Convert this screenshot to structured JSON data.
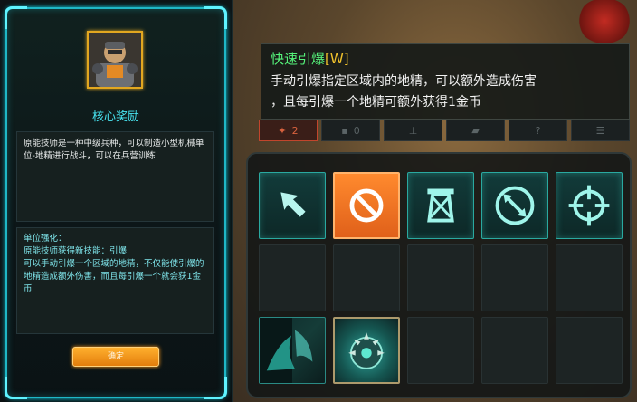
{
  "reward_panel": {
    "title": "核心奖励",
    "description": "原能技师是一种中级兵种，可以制造小型机械单位-地精进行战斗，可以在兵营训练",
    "upgrade_heading": "单位强化：",
    "upgrade_line1": "原能技师获得新技能：引爆",
    "upgrade_line2": "可以手动引爆一个区域的地精，不仅能使引爆的地精造成额外伤害，而且每引爆一个就会获1金币",
    "confirm_label": "确定"
  },
  "tooltip": {
    "title": "快速引爆",
    "hotkey": "[W]",
    "desc_line1": "手动引爆指定区域内的地精，可以额外造成伤害",
    "desc_line2": "，且每引爆一个地精可额外获得1金币"
  },
  "tabs": [
    {
      "icon": "unit-icon",
      "label": "2"
    },
    {
      "icon": "count-icon",
      "label": "0"
    },
    {
      "icon": "building-icon",
      "label": ""
    },
    {
      "icon": "flag-icon",
      "label": ""
    },
    {
      "icon": "help-icon",
      "label": "?"
    },
    {
      "icon": "list-icon",
      "label": ""
    }
  ],
  "command_slots": [
    {
      "name": "move-arrow-icon",
      "state": "skill"
    },
    {
      "name": "stop-icon",
      "state": "selected"
    },
    {
      "name": "tower-icon",
      "state": "skill"
    },
    {
      "name": "patrol-icon",
      "state": "skill"
    },
    {
      "name": "target-icon",
      "state": "skill"
    }
  ],
  "colors": {
    "accent_cyan": "#1fb7c6",
    "selected_orange": "#f07a22",
    "tooltip_title_green": "#55f27a",
    "hotkey_yellow": "#f0c22c"
  }
}
